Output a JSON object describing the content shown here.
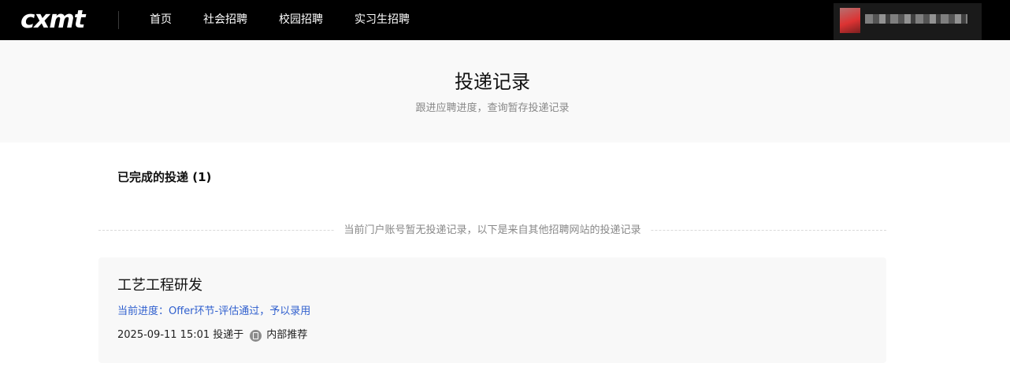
{
  "header": {
    "logo_text": "cxmt",
    "nav": [
      {
        "label": "首页"
      },
      {
        "label": "社会招聘"
      },
      {
        "label": "校园招聘"
      },
      {
        "label": "实习生招聘"
      }
    ]
  },
  "hero": {
    "title": "投递记录",
    "subtitle": "跟进应聘进度，查询暂存投递记录"
  },
  "completed": {
    "title": "已完成的投递 (1)"
  },
  "notice": "当前门户账号暂无投递记录，以下是来自其他招聘网站的投递记录",
  "applications": [
    {
      "job_title": "工艺工程研发",
      "progress": "当前进度：Offer环节-评估通过，予以录用",
      "submitted": "2025-09-11 15:01 投递于",
      "source": "内部推荐",
      "source_icon": "referral-icon"
    }
  ],
  "colors": {
    "topbar": "#000000",
    "hero_bg": "#f9f9f9",
    "progress": "#2f5fce",
    "card_bg": "#f8f8f8"
  }
}
